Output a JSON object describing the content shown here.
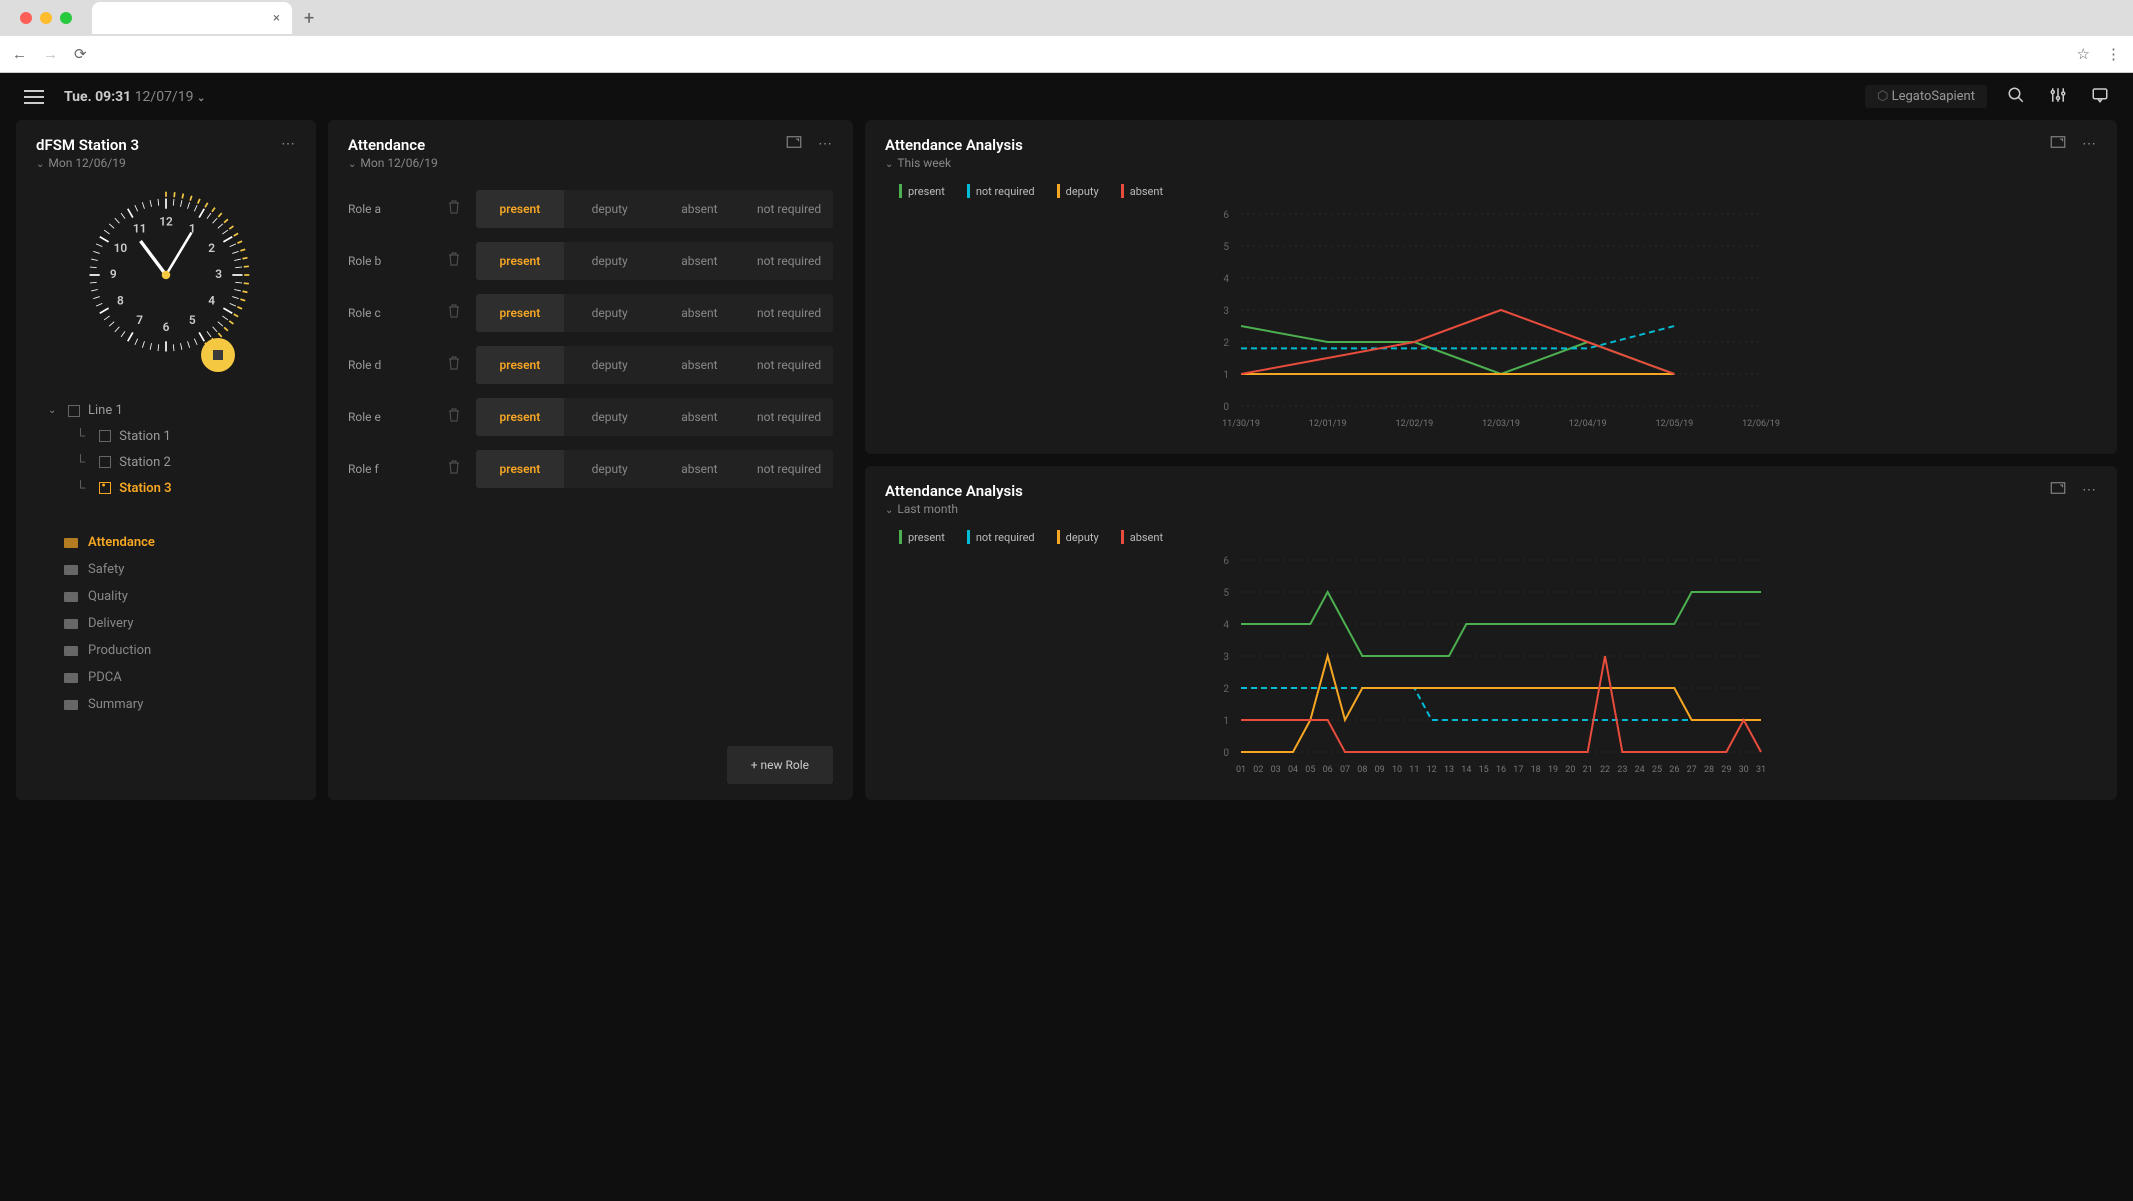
{
  "header": {
    "day": "Tue.",
    "time": "09:31",
    "date": "12/07/19",
    "brand": "LegatoSapient"
  },
  "sidebar": {
    "title": "dFSM Station 3",
    "subtitle": "Mon 12/06/19",
    "tree": {
      "line": "Line 1",
      "stations": [
        "Station 1",
        "Station 2",
        "Station 3"
      ],
      "activeIdx": 2
    },
    "nav": [
      "Attendance",
      "Safety",
      "Quality",
      "Delivery",
      "Production",
      "PDCA",
      "Summary"
    ],
    "navActive": 0
  },
  "attendance": {
    "title": "Attendance",
    "subtitle": "Mon 12/06/19",
    "statuses": [
      "present",
      "deputy",
      "absent",
      "not required"
    ],
    "roles": [
      {
        "name": "Role a",
        "active": 0
      },
      {
        "name": "Role b",
        "active": 0
      },
      {
        "name": "Role c",
        "active": 0
      },
      {
        "name": "Role d",
        "active": 0
      },
      {
        "name": "Role e",
        "active": 0
      },
      {
        "name": "Role f",
        "active": 0
      }
    ],
    "newRoleLabel": "+ new Role"
  },
  "analysis1": {
    "title": "Attendance Analysis",
    "subtitle": "This week"
  },
  "analysis2": {
    "title": "Attendance Analysis",
    "subtitle": "Last month"
  },
  "legend": {
    "present": "present",
    "notrequired": "not required",
    "deputy": "deputy",
    "absent": "absent"
  },
  "chart_data": [
    {
      "type": "line",
      "title": "Attendance Analysis — This week",
      "xlabel": "",
      "ylabel": "",
      "ylim": [
        0,
        6
      ],
      "categories": [
        "11/30/19",
        "12/01/19",
        "12/02/19",
        "12/03/19",
        "12/04/19",
        "12/05/19",
        "12/06/19"
      ],
      "series": [
        {
          "name": "present",
          "color": "#4CAF50",
          "values": [
            2.5,
            2.0,
            2.0,
            1.0,
            2.0,
            1.0,
            null
          ]
        },
        {
          "name": "not required",
          "color": "#00BCD4",
          "values": [
            1.8,
            1.8,
            1.8,
            1.8,
            1.8,
            2.5,
            null
          ],
          "dashed": true
        },
        {
          "name": "deputy",
          "color": "#F5A623",
          "values": [
            1.0,
            1.0,
            1.0,
            1.0,
            1.0,
            1.0,
            null
          ]
        },
        {
          "name": "absent",
          "color": "#E74C3C",
          "values": [
            1.0,
            1.5,
            2.0,
            3.0,
            2.0,
            1.0,
            null
          ]
        }
      ]
    },
    {
      "type": "line",
      "title": "Attendance Analysis — Last month",
      "xlabel": "",
      "ylabel": "",
      "ylim": [
        0,
        6
      ],
      "categories": [
        "01",
        "02",
        "03",
        "04",
        "05",
        "06",
        "07",
        "08",
        "09",
        "10",
        "11",
        "12",
        "13",
        "14",
        "15",
        "16",
        "17",
        "18",
        "19",
        "20",
        "21",
        "22",
        "23",
        "24",
        "25",
        "26",
        "27",
        "28",
        "29",
        "30",
        "31"
      ],
      "series": [
        {
          "name": "present",
          "color": "#4CAF50",
          "values": [
            4,
            4,
            4,
            4,
            4,
            5,
            4,
            3,
            3,
            3,
            3,
            3,
            3,
            4,
            4,
            4,
            4,
            4,
            4,
            4,
            4,
            4,
            4,
            4,
            4,
            4,
            5,
            5,
            5,
            5,
            5
          ]
        },
        {
          "name": "not required",
          "color": "#00BCD4",
          "values": [
            2,
            2,
            2,
            2,
            2,
            2,
            2,
            2,
            2,
            2,
            2,
            1,
            1,
            1,
            1,
            1,
            1,
            1,
            1,
            1,
            1,
            1,
            1,
            1,
            1,
            1,
            1,
            1,
            1,
            1,
            1
          ],
          "dashed": true
        },
        {
          "name": "deputy",
          "color": "#F5A623",
          "values": [
            0,
            0,
            0,
            0,
            1,
            3,
            1,
            2,
            2,
            2,
            2,
            2,
            2,
            2,
            2,
            2,
            2,
            2,
            2,
            2,
            2,
            2,
            2,
            2,
            2,
            2,
            1,
            1,
            1,
            1,
            1
          ]
        },
        {
          "name": "absent",
          "color": "#E74C3C",
          "values": [
            1,
            1,
            1,
            1,
            1,
            1,
            0,
            0,
            0,
            0,
            0,
            0,
            0,
            0,
            0,
            0,
            0,
            0,
            0,
            0,
            0,
            3,
            0,
            0,
            0,
            0,
            0,
            0,
            0,
            1,
            0
          ]
        }
      ]
    }
  ]
}
